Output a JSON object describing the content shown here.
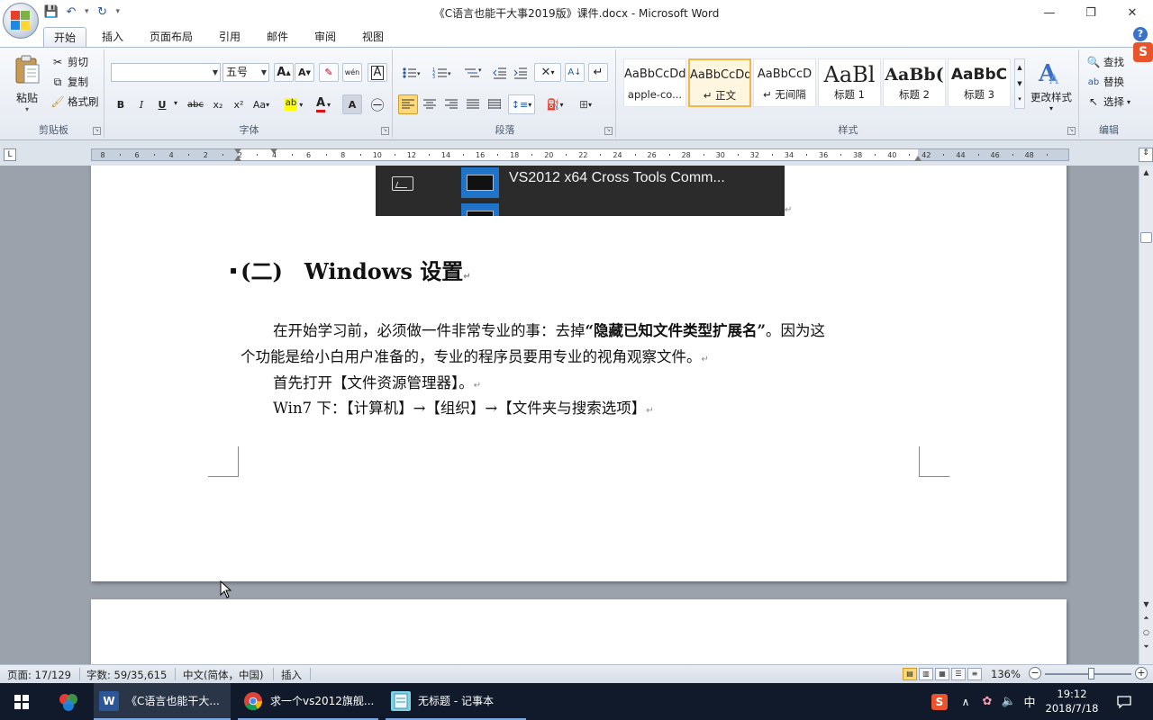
{
  "window": {
    "title": "《C语言也能干大事2019版》课件.docx - Microsoft Word",
    "minimize": "—",
    "restore": "❐",
    "close": "✕"
  },
  "qat": {
    "save": "💾",
    "undo": "↶",
    "redo": "↻",
    "more": "▾"
  },
  "tabs": [
    "开始",
    "插入",
    "页面布局",
    "引用",
    "邮件",
    "审阅",
    "视图"
  ],
  "help": "?",
  "clipboard": {
    "paste": "粘贴",
    "cut": "剪切",
    "copy": "复制",
    "format_painter": "格式刷",
    "group_label": "剪贴板"
  },
  "font": {
    "font_name": "",
    "font_size": "五号",
    "grow": "A",
    "shrink": "A",
    "clear": "✎",
    "phonetic": "wén",
    "border_char": "A",
    "bold": "B",
    "italic": "I",
    "underline": "U",
    "strike": "abc",
    "subscript": "x₂",
    "superscript": "x²",
    "change_case": "Aa",
    "highlight": "ab",
    "font_color": "A",
    "shade": "A",
    "enclose": "㊀",
    "group_label": "字体"
  },
  "paragraph": {
    "group_label": "段落"
  },
  "styles": {
    "items": [
      {
        "sample": "AaBbCcDd",
        "name": "apple-co..."
      },
      {
        "sample": "AaBbCcDd",
        "name": "↵ 正文"
      },
      {
        "sample": "AaBbCcD",
        "name": "↵ 无间隔"
      },
      {
        "sample": "AaBl",
        "name": "标题 1"
      },
      {
        "sample": "AaBb(",
        "name": "标题 2"
      },
      {
        "sample": "AaBbC",
        "name": "标题 3"
      }
    ],
    "change_styles": "更改样式",
    "group_label": "样式"
  },
  "editing": {
    "find": "查找",
    "replace": "替换",
    "select": "选择",
    "group_label": "编辑"
  },
  "ruler": {
    "corner": "L",
    "ticks": [
      "8",
      "6",
      "4",
      "2",
      "2",
      "4",
      "6",
      "8",
      "10",
      "12",
      "14",
      "16",
      "18",
      "20",
      "22",
      "24",
      "26",
      "28",
      "30",
      "32",
      "34",
      "36",
      "38",
      "40",
      "42",
      "44",
      "46",
      "48"
    ]
  },
  "document": {
    "image_caption": "VS2012 x64 Cross Tools Comm...",
    "para_mark": "↵",
    "heading": {
      "bullet": "▪",
      "number": "(二)",
      "text": "Windows 设置"
    },
    "p1_line1_pre": "在开始学习前，必须做一件非常专业的事：去掉",
    "p1_line1_bold": "“隐藏已知文件类型扩展名”",
    "p1_line1_post": "。因为这",
    "p1_line2": "个功能是给小白用户准备的，专业的程序员要用专业的视角观察文件。",
    "p2": "首先打开【文件资源管理器】。",
    "p3": "Win7 下：【计算机】→【组织】→【文件夹与搜索选项】"
  },
  "statusbar": {
    "page": "页面: 17/129",
    "words": "字数: 59/35,615",
    "language": "中文(简体，中国)",
    "mode": "插入",
    "zoom": "136%",
    "zoom_level_percent": 136
  },
  "taskbar": {
    "apps": [
      {
        "label": "《C语言也能干大...",
        "icon": "word-icon"
      },
      {
        "label": "求一个vs2012旗舰...",
        "icon": "chrome-icon"
      },
      {
        "label": "无标题 - 记事本",
        "icon": "notepad-icon"
      }
    ],
    "ime": "中",
    "time": "19:12",
    "date": "2018/7/18"
  },
  "colors": {
    "accent": "#2b579a",
    "selected_style": "#f2b649",
    "taskbar": "#101a2a"
  }
}
